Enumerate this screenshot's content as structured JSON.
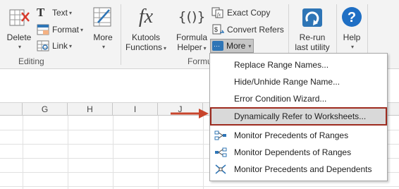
{
  "ribbon": {
    "editing": {
      "delete_label": "Delete",
      "text_label": "Text",
      "format_label": "Format",
      "link_label": "Link",
      "more_label": "More",
      "group_label": "Editing"
    },
    "kutools": {
      "label_line1": "Kutools",
      "label_line2": "Functions"
    },
    "formula": {
      "label_line1": "Formula",
      "label_line2": "Helper",
      "exact_copy_label": "Exact Copy",
      "convert_refers_label": "Convert Refers",
      "more_label": "More",
      "group_label": "Formu"
    },
    "rerun": {
      "label_line1": "Re-run",
      "label_line2": "last utility"
    },
    "help": {
      "label": "Help"
    }
  },
  "grid": {
    "columns": [
      "G",
      "H",
      "I",
      "J"
    ]
  },
  "dropdown": {
    "items": [
      {
        "label": "Replace Range Names..."
      },
      {
        "label": "Hide/Unhide Range Name..."
      },
      {
        "label": "Error Condition Wizard..."
      },
      {
        "label": "Dynamically Refer to Worksheets..."
      },
      {
        "label": "Monitor Precedents of Ranges"
      },
      {
        "label": "Monitor Dependents of Ranges"
      },
      {
        "label": "Monitor Precedents and Dependents"
      }
    ]
  },
  "colors": {
    "ribbon_bg": "#f3f3f3",
    "highlight_border": "#9e2b1f",
    "arrow": "#c8452c",
    "icon_blue": "#2e75b6",
    "help_blue": "#1f6fc4"
  }
}
